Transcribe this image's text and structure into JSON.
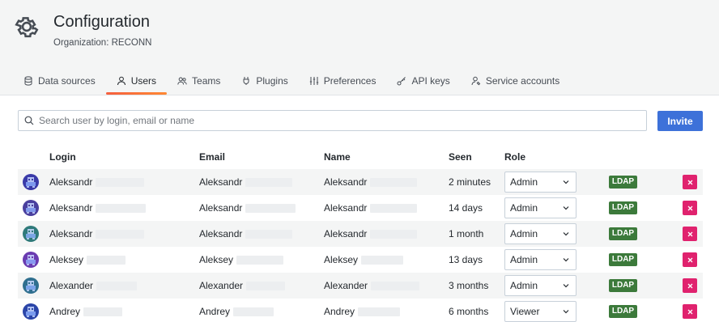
{
  "page": {
    "title": "Configuration",
    "subtitle": "Organization: RECONN"
  },
  "tabs": [
    {
      "label": "Data sources",
      "icon": "database-icon"
    },
    {
      "label": "Users",
      "icon": "user-icon",
      "active": true
    },
    {
      "label": "Teams",
      "icon": "users-icon"
    },
    {
      "label": "Plugins",
      "icon": "plug-icon"
    },
    {
      "label": "Preferences",
      "icon": "sliders-icon"
    },
    {
      "label": "API keys",
      "icon": "key-icon"
    },
    {
      "label": "Service accounts",
      "icon": "user-cog-icon"
    }
  ],
  "search": {
    "placeholder": "Search user by login, email or name",
    "value": ""
  },
  "invite_label": "Invite",
  "columns": {
    "login": "Login",
    "email": "Email",
    "name": "Name",
    "seen": "Seen",
    "role": "Role"
  },
  "users": [
    {
      "login": "Aleksandr",
      "email": "Aleksandr",
      "name": "Aleksandr",
      "seen": "2 minutes",
      "role": "Admin",
      "badge": "LDAP",
      "avatar_color": "#3a3aa8"
    },
    {
      "login": "Aleksandr",
      "email": "Aleksandr",
      "name": "Aleksandr",
      "seen": "14 days",
      "role": "Admin",
      "badge": "LDAP",
      "avatar_color": "#4a3f9e"
    },
    {
      "login": "Aleksandr",
      "email": "Aleksandr",
      "name": "Aleksandr",
      "seen": "1 month",
      "role": "Admin",
      "badge": "LDAP",
      "avatar_color": "#2f7a7a"
    },
    {
      "login": "Aleksey",
      "email": "Aleksey",
      "name": "Aleksey",
      "seen": "13 days",
      "role": "Admin",
      "badge": "LDAP",
      "avatar_color": "#6a3bb0"
    },
    {
      "login": "Alexander",
      "email": "Alexander",
      "name": "Alexander",
      "seen": "3 months",
      "role": "Admin",
      "badge": "LDAP",
      "avatar_color": "#2f6f8f"
    },
    {
      "login": "Andrey",
      "email": "Andrey",
      "name": "Andrey",
      "seen": "6 months",
      "role": "Viewer",
      "badge": "LDAP",
      "avatar_color": "#2b45a8"
    }
  ],
  "colors": {
    "accent": "#3d71d9",
    "ldap": "#3c7a3b",
    "delete": "#e0226e",
    "tab_underline": "#f55f3e"
  }
}
